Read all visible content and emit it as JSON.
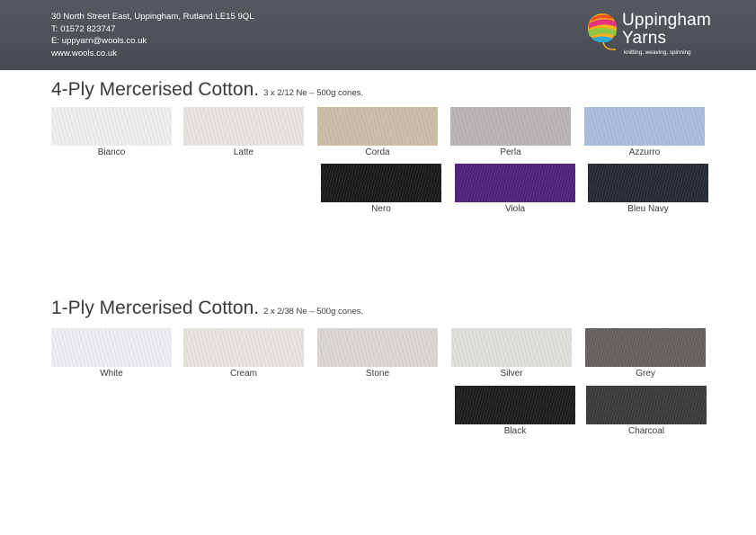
{
  "contact": {
    "address": "30 North Street East, Uppingham, Rutland LE15 9QL",
    "phone": "T: 01572 823747",
    "email": "E: uppyarn@wools.co.uk",
    "website": "www.wools.co.uk"
  },
  "logo": {
    "name_line1": "Uppingham",
    "name_line2": "Yarns",
    "tagline": "knitting, weaving, spinning"
  },
  "sections": [
    {
      "title": "4-Ply Mercerised Cotton.",
      "subtitle": "3 x 2/12 Ne – 500g cones.",
      "swatches": [
        {
          "name": "Bianco",
          "color": "#eeeeee"
        },
        {
          "name": "Latte",
          "color": "#e7e4e0"
        },
        {
          "name": "Corda",
          "color": "#cdbda6"
        },
        {
          "name": "Perla",
          "color": "#b9b3b6"
        },
        {
          "name": "Azzurro",
          "color": "#a9bcdb"
        },
        {
          "name": "Nero",
          "color": "#18181a"
        },
        {
          "name": "Viola",
          "color": "#4e1f7a"
        },
        {
          "name": "Bleu Navy",
          "color": "#23272f"
        }
      ]
    },
    {
      "title": "1-Ply Mercerised Cotton.",
      "subtitle": "2 x 2/38 Ne – 500g cones.",
      "swatches": [
        {
          "name": "White",
          "color": "#edeef2"
        },
        {
          "name": "Cream",
          "color": "#e6e2dd"
        },
        {
          "name": "Stone",
          "color": "#d9d6d4"
        },
        {
          "name": "Silver",
          "color": "#e1dfdc"
        },
        {
          "name": "Grey",
          "color": "#635d5c"
        },
        {
          "name": "Black",
          "color": "#1b1b1d"
        },
        {
          "name": "Charcoal",
          "color": "#39393b"
        }
      ]
    }
  ]
}
